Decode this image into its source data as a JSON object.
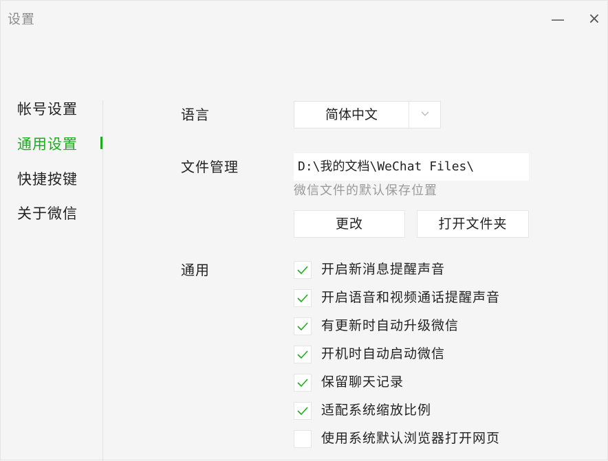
{
  "window": {
    "title": "设置",
    "minimize_icon": "minimize-icon",
    "close_icon": "close-icon"
  },
  "sidebar": {
    "items": [
      {
        "label": "帐号设置",
        "active": false
      },
      {
        "label": "通用设置",
        "active": true
      },
      {
        "label": "快捷按键",
        "active": false
      },
      {
        "label": "关于微信",
        "active": false
      }
    ],
    "accent_color": "#1aad19"
  },
  "language": {
    "label": "语言",
    "value": "简体中文",
    "dropdown_icon": "chevron-down-icon"
  },
  "file_management": {
    "label": "文件管理",
    "path": "D:\\我的文档\\WeChat Files\\",
    "hint": "微信文件的默认保存位置",
    "change_button": "更改",
    "open_folder_button": "打开文件夹"
  },
  "general": {
    "label": "通用",
    "options": [
      {
        "label": "开启新消息提醒声音",
        "checked": true
      },
      {
        "label": "开启语音和视频通话提醒声音",
        "checked": true
      },
      {
        "label": "有更新时自动升级微信",
        "checked": true
      },
      {
        "label": "开机时自动启动微信",
        "checked": true
      },
      {
        "label": "保留聊天记录",
        "checked": true
      },
      {
        "label": "适配系统缩放比例",
        "checked": true
      },
      {
        "label": "使用系统默认浏览器打开网页",
        "checked": false
      }
    ]
  }
}
